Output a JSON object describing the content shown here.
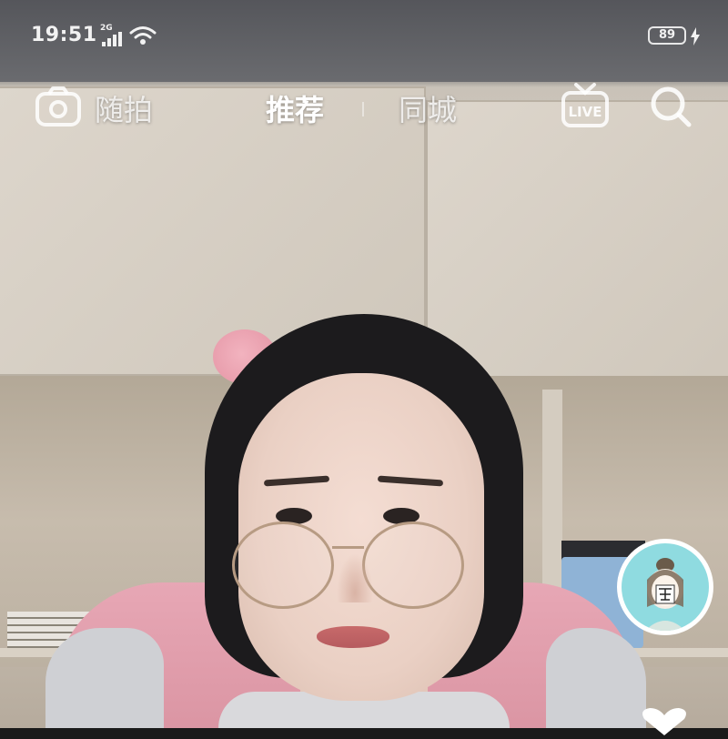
{
  "status_bar": {
    "time": "19:51",
    "network_type": "2G",
    "battery": "89",
    "icons": [
      "signal-icon",
      "wifi-icon",
      "battery-icon",
      "charging-icon"
    ]
  },
  "top_nav": {
    "camera_label": "随拍",
    "tabs": [
      {
        "label": "推荐",
        "active": true
      },
      {
        "label": "同城",
        "active": false
      }
    ],
    "icons": [
      "camera-icon",
      "live-icon",
      "search-icon"
    ],
    "live_badge": "LIVE"
  },
  "colors": {
    "active_tab": "#ffffff",
    "inactive_tab": "rgba(255,255,255,0.78)",
    "avatar_bg": "#8fdbe0"
  },
  "side": {
    "icons": [
      "creator-avatar",
      "like-heart-icon"
    ]
  }
}
